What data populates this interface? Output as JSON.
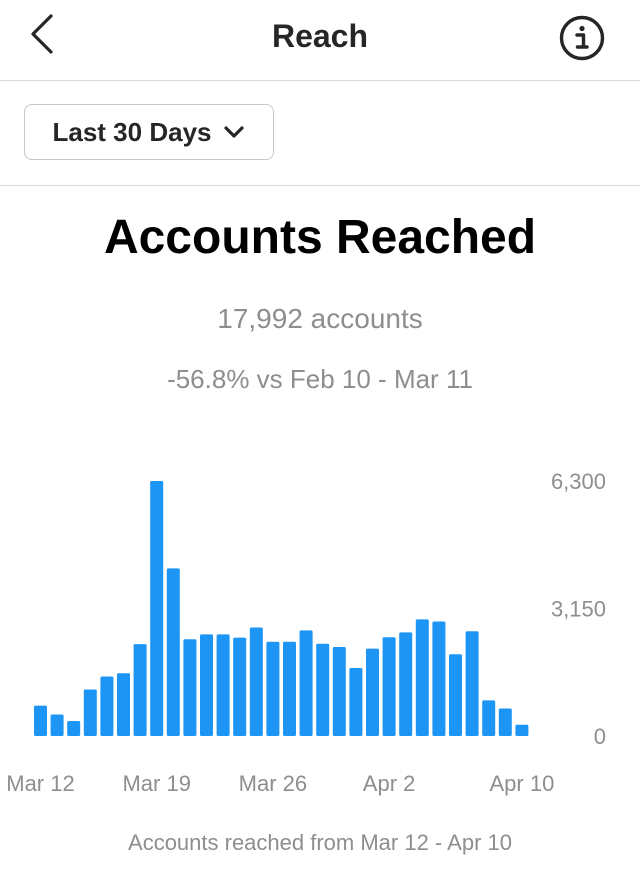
{
  "header": {
    "title": "Reach",
    "back_icon": "chevron-left-icon",
    "info_icon": "info-circle-icon"
  },
  "filter": {
    "label": "Last 30 Days",
    "icon": "chevron-down-icon"
  },
  "summary": {
    "heading": "Accounts Reached",
    "count": "17,992 accounts",
    "comparison": "-56.8% vs Feb 10 - Mar 11"
  },
  "footnote": "Accounts reached from Mar 12 - Apr 10",
  "colors": {
    "bar": "#1c95f5",
    "muted_text": "#8e8e8e",
    "divider": "#dbdbdb"
  },
  "chart_data": {
    "type": "bar",
    "title": "",
    "xlabel": "",
    "ylabel": "",
    "ylim": [
      0,
      6300
    ],
    "y_ticks": [
      {
        "value": 0,
        "label": "0"
      },
      {
        "value": 3150,
        "label": "3,150"
      },
      {
        "value": 6300,
        "label": "6,300"
      }
    ],
    "x_ticks": [
      {
        "index": 0,
        "label": "Mar 12"
      },
      {
        "index": 7,
        "label": "Mar 19"
      },
      {
        "index": 14,
        "label": "Mar 26"
      },
      {
        "index": 21,
        "label": "Apr 2"
      },
      {
        "index": 29,
        "label": "Apr 10"
      }
    ],
    "categories": [
      "Mar 12",
      "Mar 13",
      "Mar 14",
      "Mar 15",
      "Mar 16",
      "Mar 17",
      "Mar 18",
      "Mar 19",
      "Mar 20",
      "Mar 21",
      "Mar 22",
      "Mar 23",
      "Mar 24",
      "Mar 25",
      "Mar 26",
      "Mar 27",
      "Mar 28",
      "Mar 29",
      "Mar 30",
      "Mar 31",
      "Apr 1",
      "Apr 2",
      "Apr 3",
      "Apr 4",
      "Apr 5",
      "Apr 6",
      "Apr 7",
      "Apr 8",
      "Apr 9",
      "Apr 10"
    ],
    "values": [
      750,
      530,
      370,
      1150,
      1470,
      1550,
      2270,
      6300,
      4140,
      2390,
      2510,
      2510,
      2430,
      2680,
      2330,
      2330,
      2610,
      2280,
      2200,
      1680,
      2160,
      2440,
      2560,
      2880,
      2830,
      2020,
      2590,
      880,
      680,
      280
    ]
  }
}
